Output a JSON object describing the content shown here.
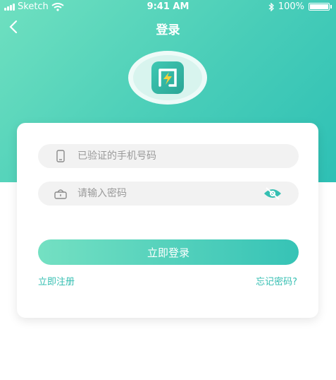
{
  "status_bar": {
    "carrier": "Sketch",
    "time": "9:41 AM",
    "battery": "100%"
  },
  "nav": {
    "title": "登录"
  },
  "form": {
    "phone_placeholder": "已验证的手机号码",
    "password_placeholder": "请输入密码",
    "login_label": "立即登录",
    "register_label": "立即注册",
    "forgot_label": "忘记密码?"
  },
  "colors": {
    "accent": "#36c3b6",
    "accent_light": "#74e0c2",
    "field_bg": "#f2f2f2"
  },
  "icons": [
    "wifi-icon",
    "bluetooth-icon",
    "battery-icon",
    "back-chevron-icon",
    "app-logo-icon",
    "phone-icon",
    "lock-icon",
    "eye-closed-icon"
  ]
}
